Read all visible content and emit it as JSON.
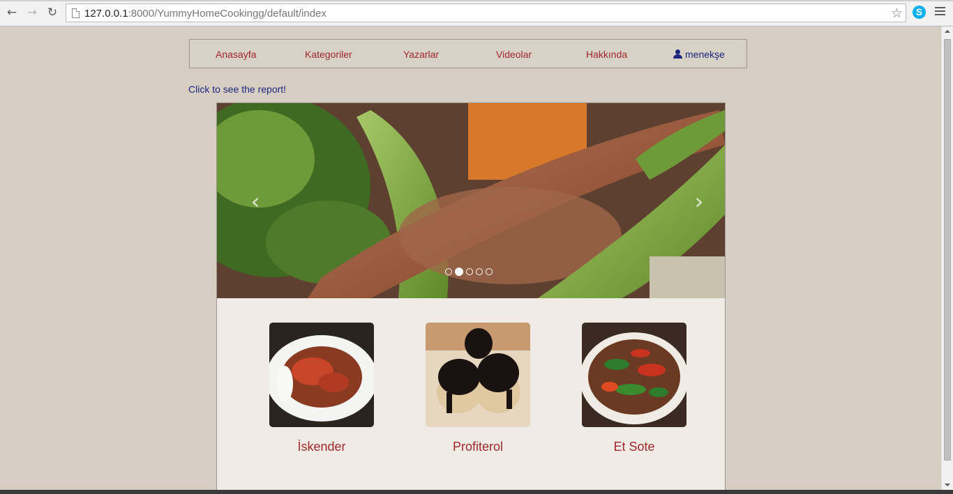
{
  "browser": {
    "url_host": "127.0.0.1",
    "url_rest": ":8000/YummyHomeCookingg/default/index",
    "back_icon": "←",
    "forward_icon": "→",
    "reload_icon": "↻",
    "star_icon": "☆",
    "skype_letter": "S"
  },
  "nav": {
    "items": [
      {
        "label": "Anasayfa"
      },
      {
        "label": "Kategoriler"
      },
      {
        "label": "Yazarlar"
      },
      {
        "label": "Videolar"
      },
      {
        "label": "Hakkında"
      }
    ],
    "user": "menekşe"
  },
  "report_link": "Click to see the report!",
  "carousel": {
    "prev_icon": "‹",
    "next_icon": "›",
    "slide_count": 5,
    "active_index": 1
  },
  "dishes": [
    {
      "name": "İskender",
      "colors": [
        "#7a2a1a",
        "#c8452a",
        "#ffffff"
      ]
    },
    {
      "name": "Profiterol",
      "colors": [
        "#1a1210",
        "#e8d7c0",
        "#f2ede6"
      ]
    },
    {
      "name": "Et Sote",
      "colors": [
        "#2e7d2e",
        "#c8321e",
        "#6b3a22"
      ]
    }
  ],
  "colors": {
    "link_red": "#a0282c",
    "link_blue": "#1c2580",
    "page_bg": "#d6cec3"
  }
}
